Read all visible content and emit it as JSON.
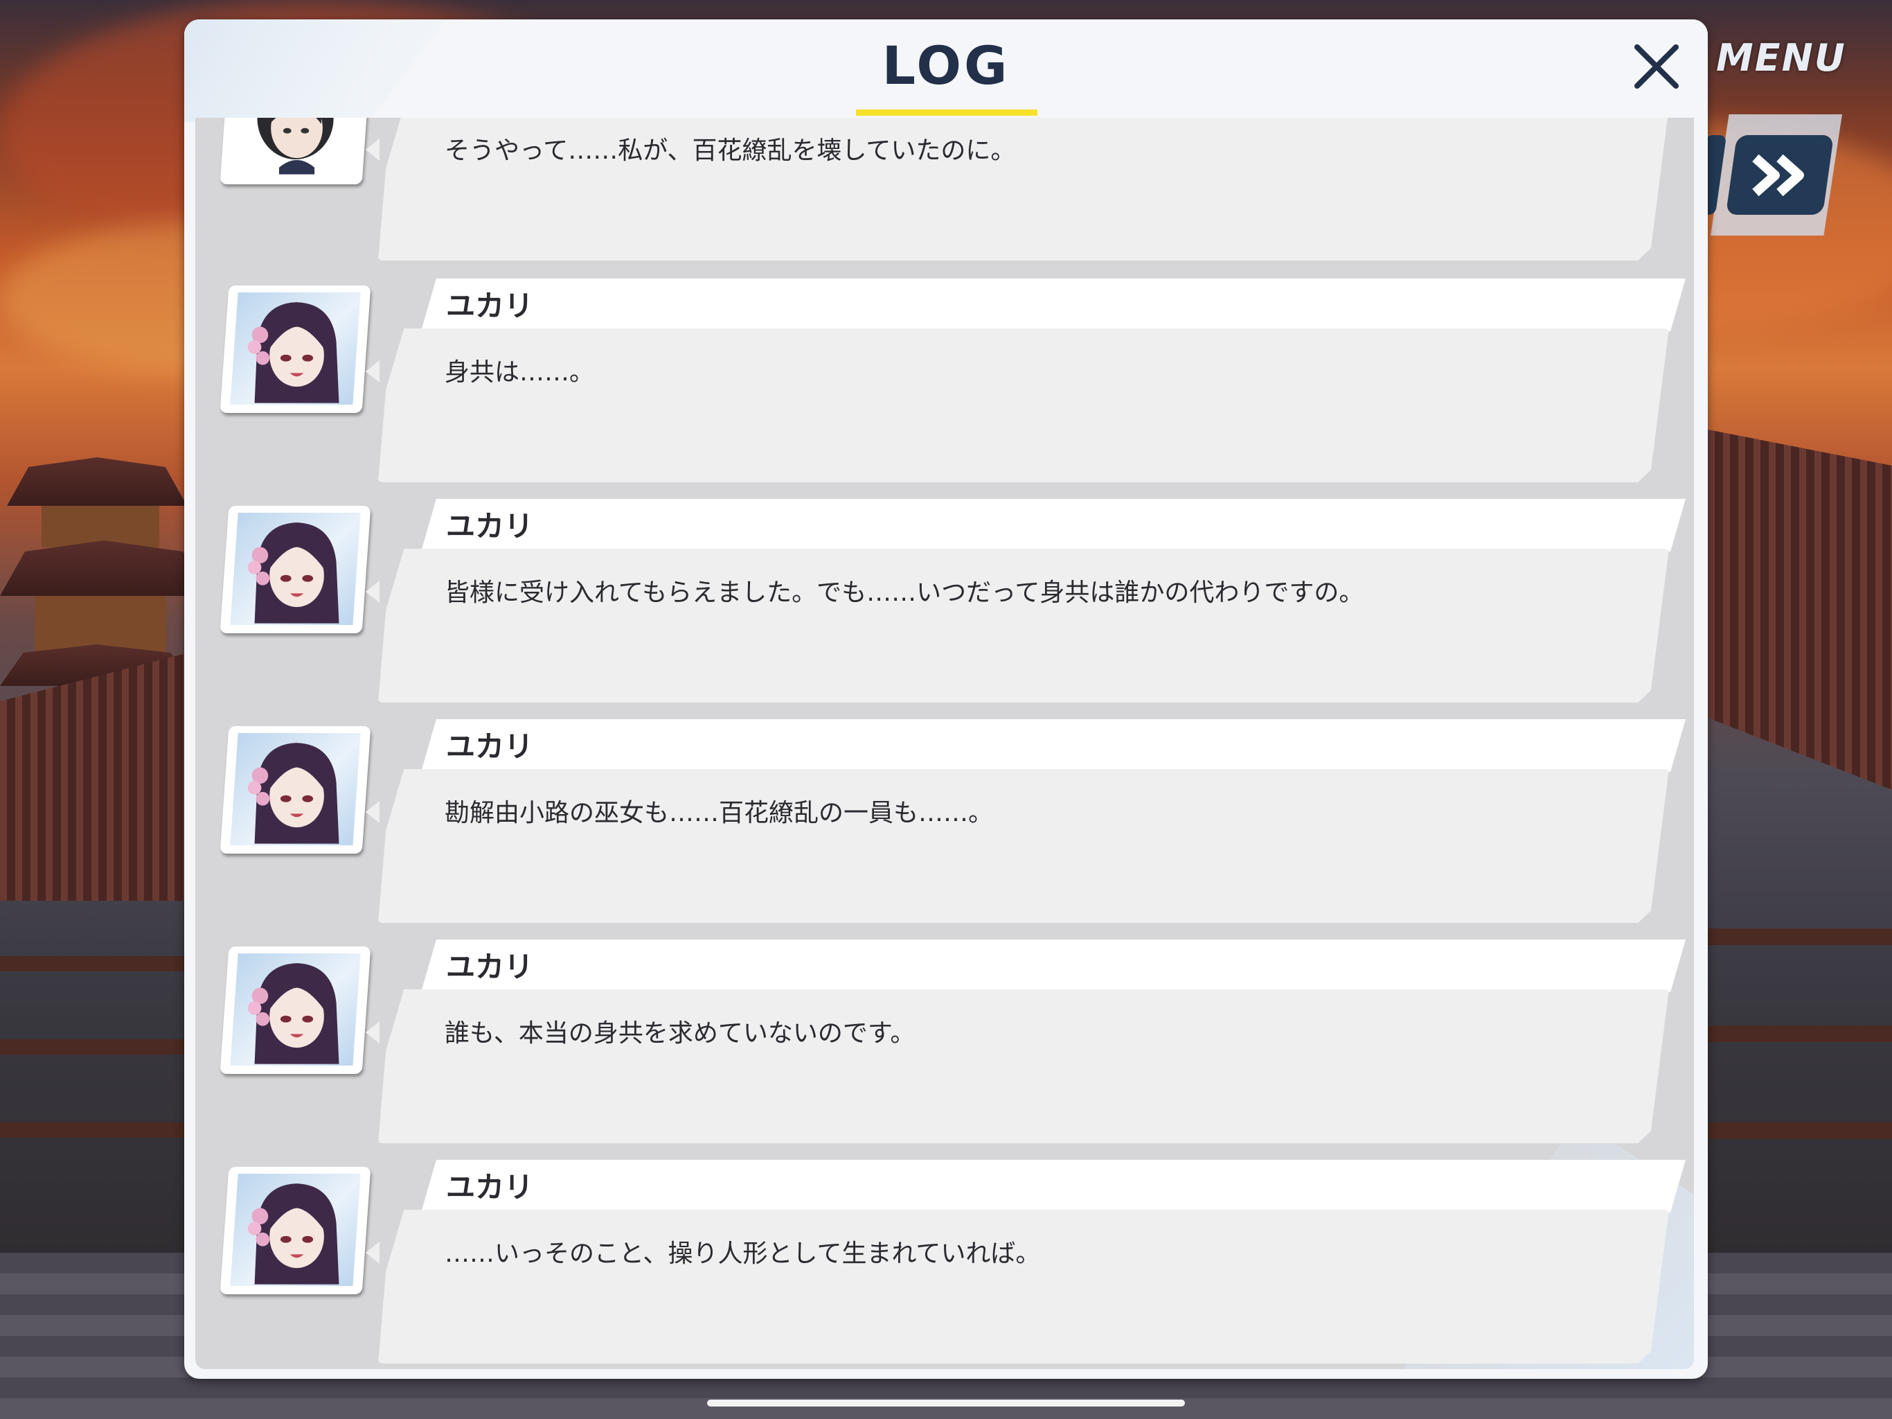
{
  "header": {
    "title": "LOG",
    "close_icon": "close-icon"
  },
  "menu": {
    "label": "MENU",
    "fast_forward_icon": "fast-forward-icon"
  },
  "colors": {
    "title": "#223049",
    "underline": "#f7e22a",
    "panel": "#f4f6f9",
    "scroll_bg": "#d6d6d8"
  },
  "log": {
    "entries": [
      {
        "speaker": "",
        "avatar": "short-black-hair-girl",
        "text": "そうやって……私が、百花繚乱を壊していたのに。"
      },
      {
        "speaker": "ユカリ",
        "avatar": "yukari",
        "text": "身共は……。"
      },
      {
        "speaker": "ユカリ",
        "avatar": "yukari",
        "text": "皆様に受け入れてもらえました。でも……いつだって身共は誰かの代わりですの。"
      },
      {
        "speaker": "ユカリ",
        "avatar": "yukari",
        "text": "勘解由小路の巫女も……百花繚乱の一員も……。"
      },
      {
        "speaker": "ユカリ",
        "avatar": "yukari",
        "text": "誰も、本当の身共を求めていないのです。"
      },
      {
        "speaker": "ユカリ",
        "avatar": "yukari",
        "text": "……いっそのこと、操り人形として生まれていれば。"
      }
    ]
  }
}
